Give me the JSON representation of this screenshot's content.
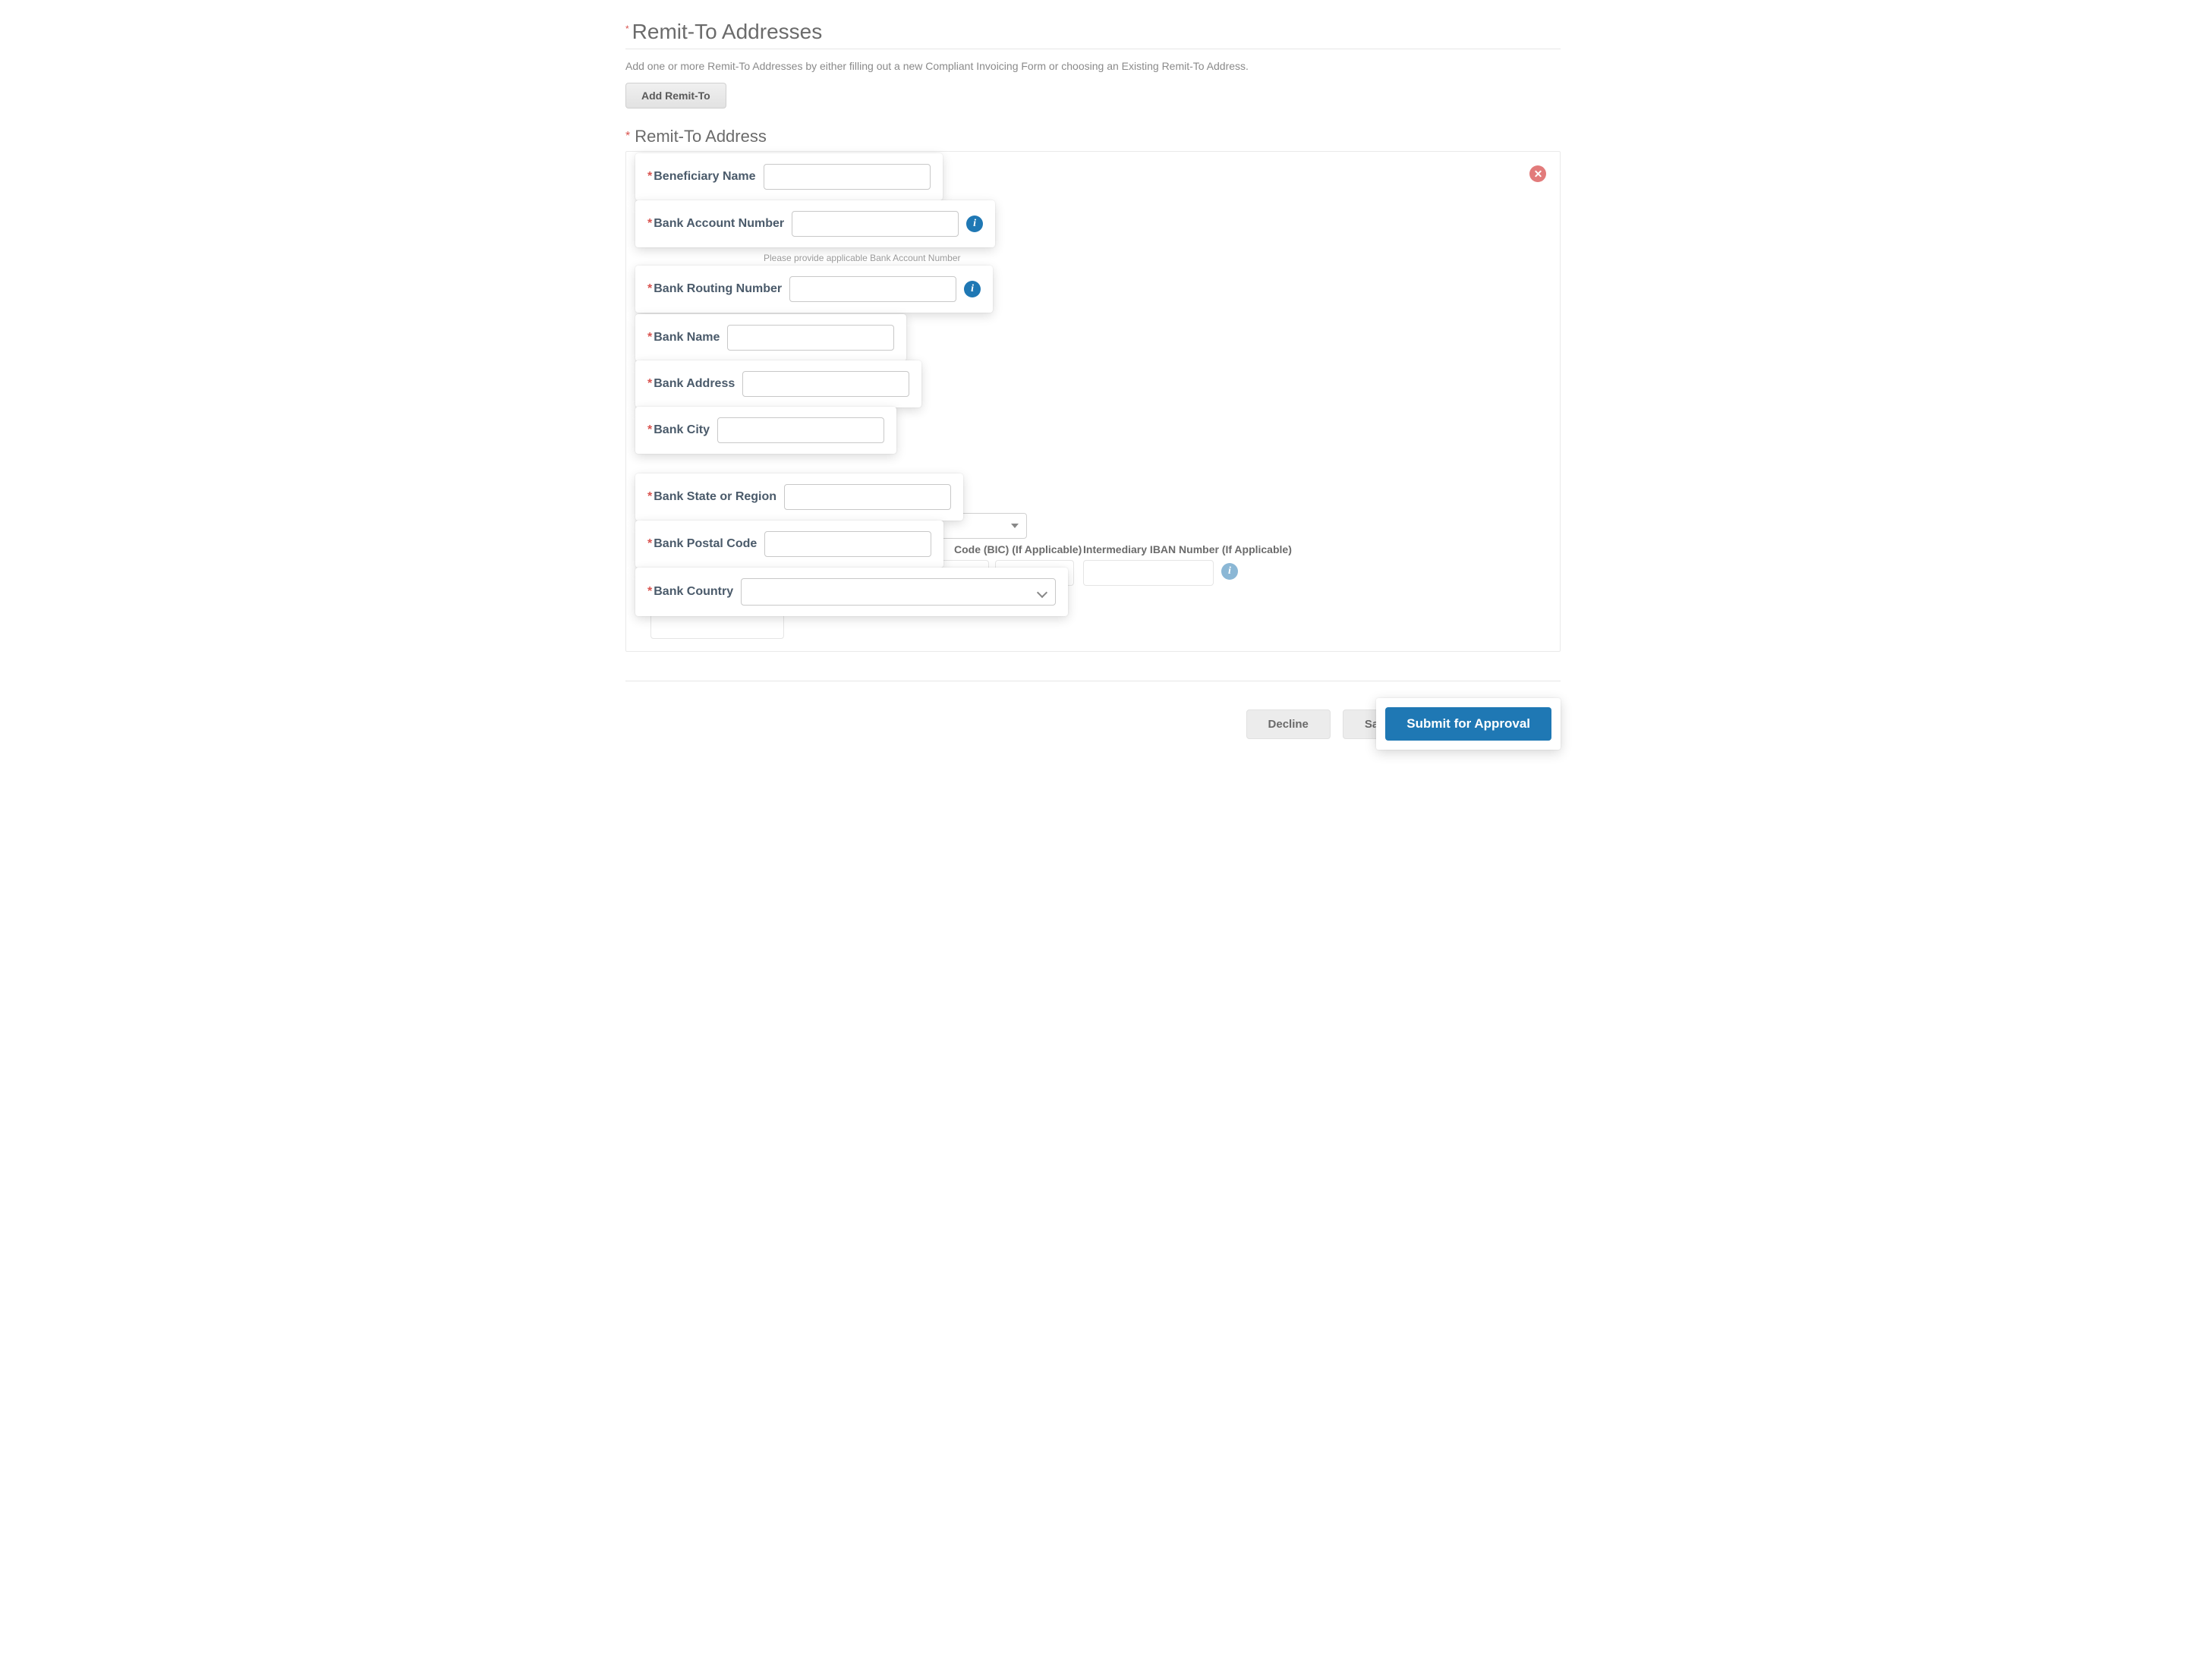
{
  "section": {
    "title": "Remit-To Addresses",
    "help": "Add one or more Remit-To Addresses by either filling out a new Compliant Invoicing Form or choosing an Existing Remit-To Address.",
    "add_button": "Add Remit-To"
  },
  "subsection": {
    "title": "Remit-To Address"
  },
  "fields": {
    "beneficiary_name": {
      "label": "Beneficiary Name"
    },
    "bank_account_number": {
      "label": "Bank Account Number",
      "helper": "Please provide applicable Bank Account Number"
    },
    "bank_routing_number": {
      "label": "Bank Routing Number"
    },
    "bank_name": {
      "label": "Bank Name"
    },
    "bank_address": {
      "label": "Bank Address"
    },
    "bank_city": {
      "label": "Bank City"
    },
    "bank_state": {
      "label": "Bank State or Region"
    },
    "bank_postal": {
      "label": "Bank Postal Code"
    },
    "bank_country": {
      "label": "Bank Country"
    }
  },
  "background": {
    "beneficiary_name_shadow": "Beneficiary Name",
    "bank_name_shadow": "Bank Name",
    "intermediary_bic_label": "Code (BIC) (If Applicable)",
    "intermediary_iban_label": "Intermediary IBAN Number (If Applicable)"
  },
  "footer": {
    "decline": "Decline",
    "save_partial": "Sa",
    "submit": "Submit for Approval"
  },
  "glyphs": {
    "info": "i"
  }
}
